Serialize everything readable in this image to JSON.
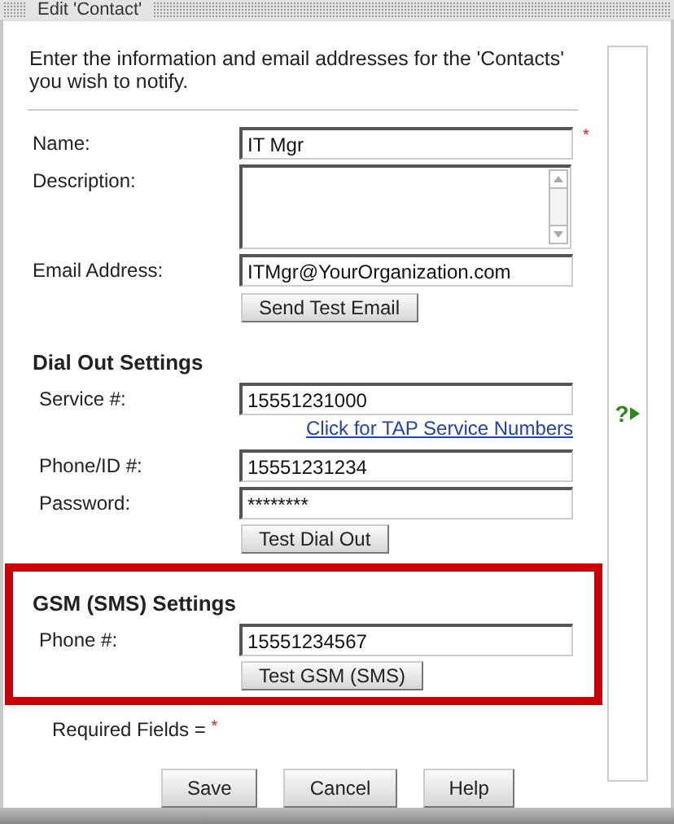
{
  "window": {
    "title": "Edit 'Contact'"
  },
  "intro": "Enter the information and email addresses for the 'Contacts' you wish to notify.",
  "contact_fields": [
    {
      "label": "Name:",
      "kind": "input",
      "value": "IT Mgr",
      "required": true
    },
    {
      "label": "Description:",
      "kind": "textarea",
      "required": false
    },
    {
      "label": "Email Address:",
      "kind": "input",
      "value": "ITMgr@YourOrganization.com",
      "required": false
    }
  ],
  "test_email_button": "Send Test Email",
  "sections": [
    {
      "heading": "Dial Out Settings",
      "highlighted": false,
      "fields": [
        {
          "label": "Service #:",
          "value": "15551231000",
          "link": "Click for TAP Service Numbers"
        },
        {
          "label": "Phone/ID #:",
          "value": "15551231234"
        },
        {
          "label": "Password:",
          "value": "********"
        }
      ],
      "button": "Test Dial Out"
    },
    {
      "heading": "GSM (SMS) Settings",
      "highlighted": true,
      "fields": [
        {
          "label": "Phone #:",
          "value": "15551234567"
        }
      ],
      "button": "Test GSM (SMS)"
    }
  ],
  "required_note": {
    "label": "Required Fields =",
    "mark": "*"
  },
  "help_marker": "?",
  "buttons": [
    "Save",
    "Cancel",
    "Help"
  ]
}
